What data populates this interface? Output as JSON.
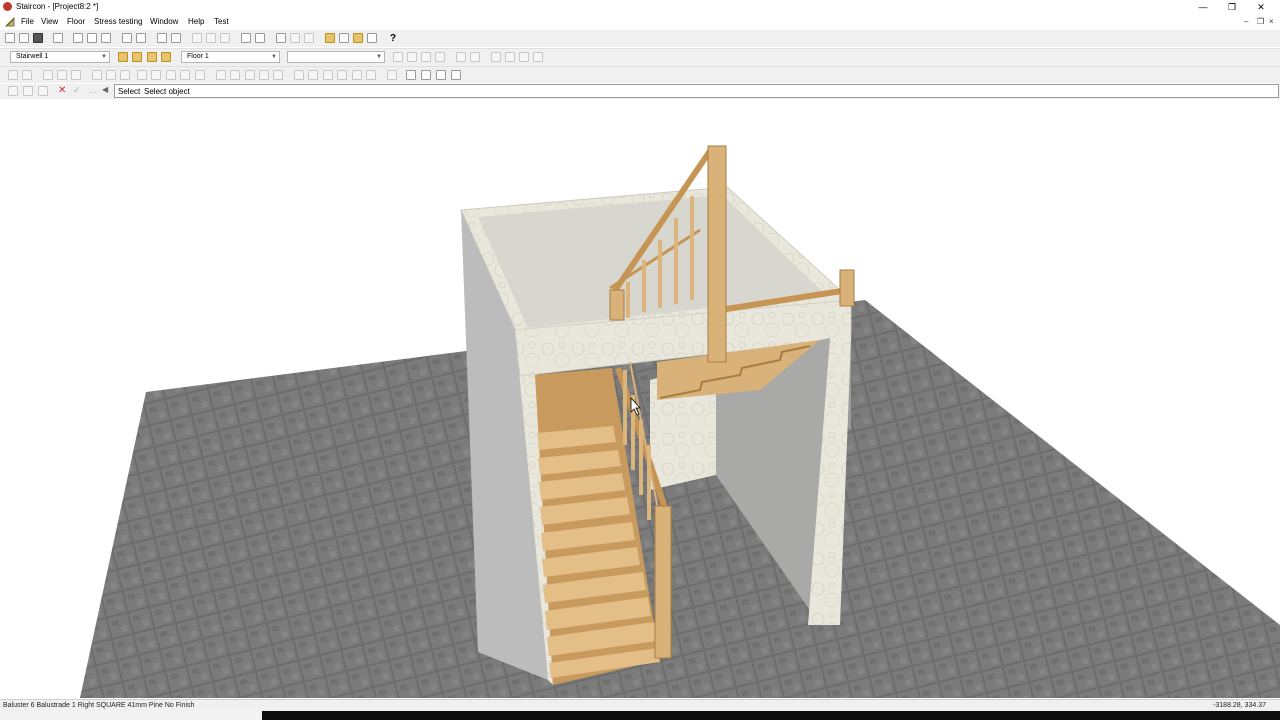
{
  "window": {
    "title": "Staircon - [Project8:2 *]",
    "minimize_glyph": "—",
    "restore_glyph": "❐",
    "close_glyph": "✕"
  },
  "menu": {
    "items": [
      "File",
      "View",
      "Floor",
      "Stress testing",
      "Window",
      "Help",
      "Test"
    ],
    "mdi": {
      "minimize": "–",
      "restore": "❐",
      "close": "×"
    }
  },
  "toolbar": {
    "help_glyph": "?",
    "stairwell_combo": "Stairwell 1",
    "floor_combo": "Floor 1",
    "empty_combo": ""
  },
  "command": {
    "label": "Select",
    "prompt": "Select object"
  },
  "status": {
    "text": "Baluster 6 Balustrade 1 Right SQUARE 41mm Pine No Finish",
    "coords": "-3188.28, 334.37"
  },
  "colors": {
    "floor_tile": "#6d6d6d",
    "wall_outer": "#bcbcbc",
    "plaster": "#e9e7dc",
    "pine": "#d9b27a",
    "pine_dark": "#b98a4e"
  }
}
